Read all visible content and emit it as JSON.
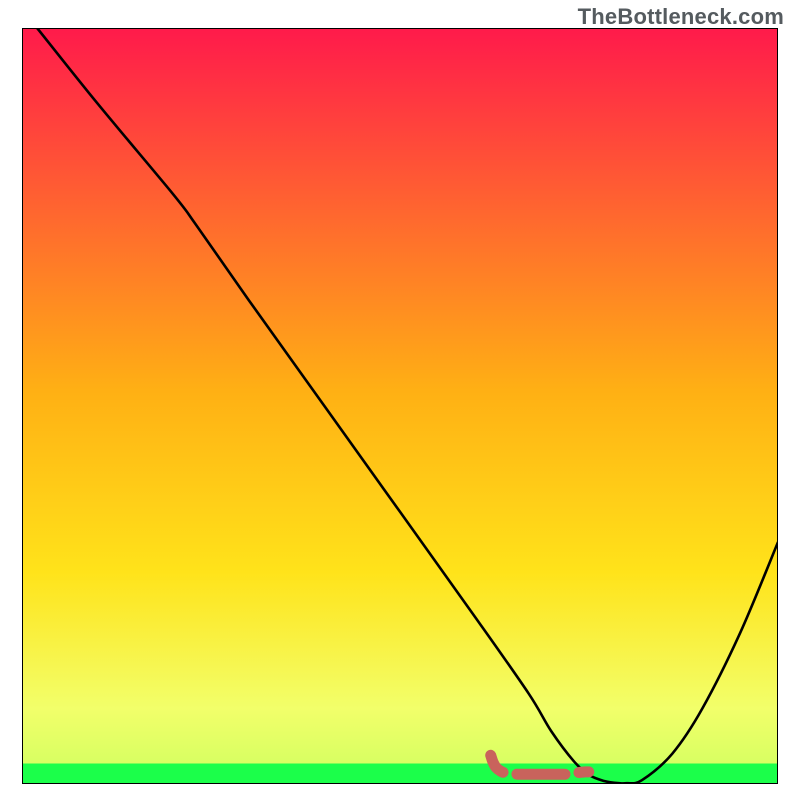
{
  "watermark": {
    "text": "TheBottleneck.com"
  },
  "colors": {
    "gradient_top": "#ff1a4b",
    "gradient_mid": "#ffcf1f",
    "gradient_low": "#f6ff66",
    "gradient_bottom": "#1bff4a",
    "curve": "#000000",
    "squiggle": "#c9635c",
    "frame": "#000000"
  },
  "chart_data": {
    "type": "line",
    "title": "",
    "xlabel": "",
    "ylabel": "",
    "xlim": [
      0,
      100
    ],
    "ylim": [
      0,
      100
    ],
    "grid": false,
    "series": [
      {
        "name": "bottleneck-curve",
        "x": [
          2,
          10,
          20,
          23,
          30,
          40,
          50,
          60,
          67,
          70,
          73,
          75,
          77,
          79,
          80,
          82,
          86,
          90,
          95,
          100
        ],
        "y": [
          100,
          90,
          78,
          74,
          64,
          50,
          36,
          22,
          12,
          7,
          3,
          1.2,
          0.4,
          0.1,
          0.1,
          0.5,
          4,
          10,
          20,
          32
        ]
      }
    ],
    "squiggle": {
      "name": "cursor-squiggle",
      "points": [
        [
          62.0,
          3.8
        ],
        [
          62.3,
          2.9
        ],
        [
          62.7,
          2.2
        ],
        [
          63.3,
          1.7
        ],
        [
          64.2,
          1.4
        ],
        [
          65.5,
          1.3
        ],
        [
          67.5,
          1.3
        ],
        [
          70.0,
          1.3
        ],
        [
          72.0,
          1.3
        ],
        [
          73.5,
          1.5
        ],
        [
          74.5,
          1.6
        ],
        [
          75.2,
          1.6
        ],
        [
          77.0,
          1.6
        ],
        [
          77.8,
          1.6
        ]
      ]
    }
  }
}
